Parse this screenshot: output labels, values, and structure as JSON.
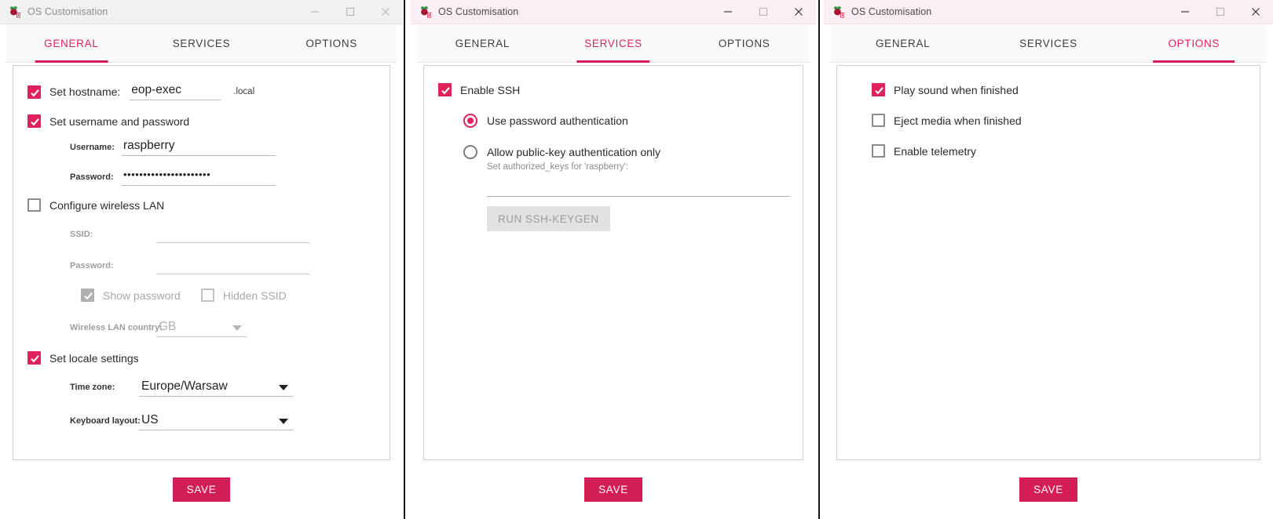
{
  "app": {
    "title": "OS Customisation",
    "icon": "raspberry-icon",
    "accent_color": "#e0215c",
    "save_button_color": "#d21e55",
    "titlebar_active_color": "#fbeef5",
    "titlebar_inactive_color": "#f1f1f1"
  },
  "window_controls": {
    "minimize": "minimize-icon",
    "maximize": "maximize-icon",
    "close": "close-icon"
  },
  "tabs": {
    "general": "GENERAL",
    "services": "SERVICES",
    "options": "OPTIONS"
  },
  "footer": {
    "save_label": "SAVE"
  },
  "windows": [
    {
      "active_tab": "GENERAL",
      "focused": false
    },
    {
      "active_tab": "SERVICES",
      "focused": true
    },
    {
      "active_tab": "OPTIONS",
      "focused": true
    }
  ],
  "general": {
    "set_hostname": {
      "label": "Set hostname:",
      "checked": true,
      "value": "eop-exec",
      "suffix": ".local"
    },
    "set_username_password": {
      "label": "Set username and password",
      "checked": true,
      "username_label": "Username:",
      "username_value": "raspberry",
      "password_label": "Password:",
      "password_value": "••••••••••••••••••••••"
    },
    "configure_wireless_lan": {
      "label": "Configure wireless LAN",
      "checked": false,
      "ssid_label": "SSID:",
      "ssid_value": "",
      "password_label": "Password:",
      "password_value": "",
      "show_password_label": "Show password",
      "show_password_checked": true,
      "hidden_ssid_label": "Hidden SSID",
      "hidden_ssid_checked": false,
      "country_label": "Wireless LAN country:",
      "country_value": "GB"
    },
    "set_locale_settings": {
      "label": "Set locale settings",
      "checked": true,
      "timezone_label": "Time zone:",
      "timezone_value": "Europe/Warsaw",
      "keyboard_label": "Keyboard layout:",
      "keyboard_value": "US"
    }
  },
  "services": {
    "enable_ssh": {
      "label": "Enable SSH",
      "checked": true
    },
    "password_auth": {
      "label": "Use password authentication",
      "selected": true
    },
    "publickey_auth": {
      "label": "Allow public-key authentication only",
      "selected": false
    },
    "authorized_keys_hint": "Set authorized_keys for 'raspberry':",
    "authorized_keys_value": "",
    "keygen_button": "RUN SSH-KEYGEN"
  },
  "options": {
    "play_sound": {
      "label": "Play sound when finished",
      "checked": true
    },
    "eject_media": {
      "label": "Eject media when finished",
      "checked": false
    },
    "enable_telemetry": {
      "label": "Enable telemetry",
      "checked": false
    }
  }
}
